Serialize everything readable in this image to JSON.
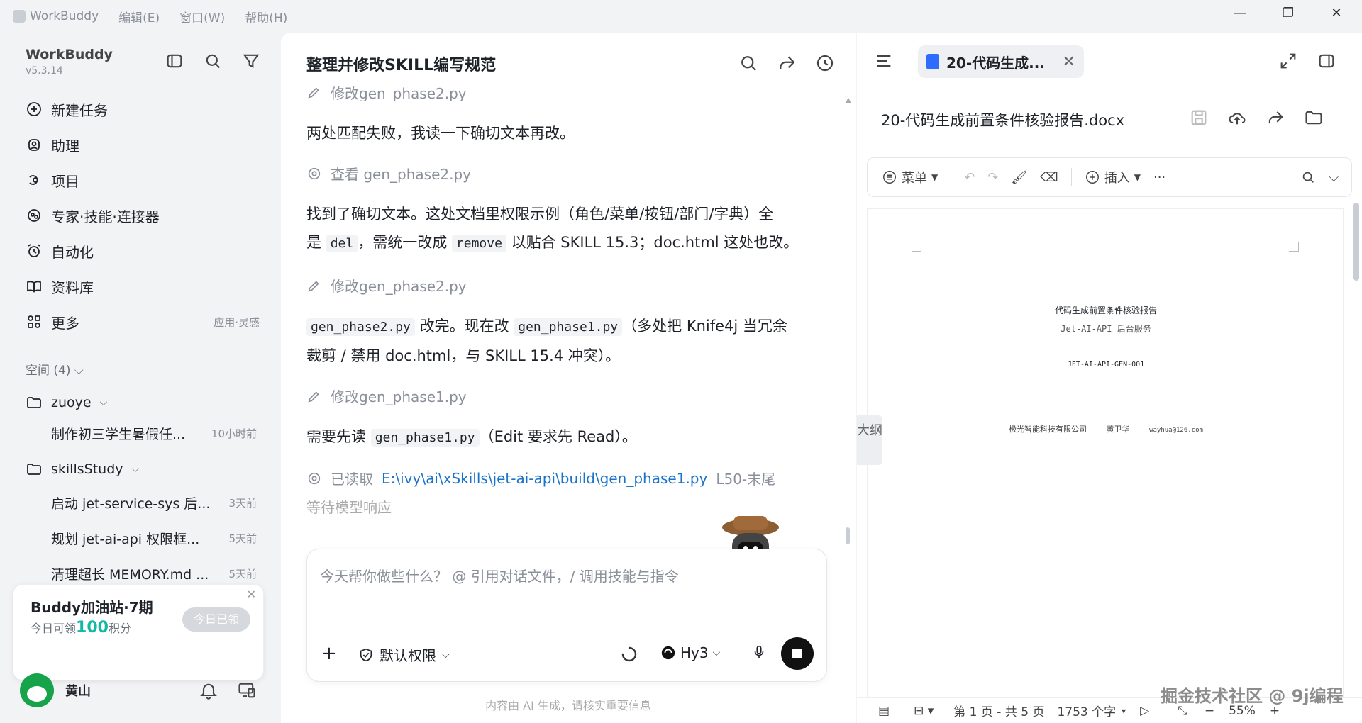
{
  "titlebar": {
    "app_name": "WorkBuddy",
    "menus": [
      "编辑(E)",
      "窗口(W)",
      "帮助(H)"
    ]
  },
  "sidebar": {
    "app_name": "WorkBuddy",
    "version": "v5.3.14",
    "nav": [
      {
        "label": "新建任务",
        "icon": "plus-circle-icon"
      },
      {
        "label": "助理",
        "icon": "assistant-icon"
      },
      {
        "label": "项目",
        "icon": "project-icon"
      },
      {
        "label": "专家·技能·连接器",
        "icon": "skills-icon"
      },
      {
        "label": "自动化",
        "icon": "alarm-icon"
      },
      {
        "label": "资料库",
        "icon": "book-icon"
      },
      {
        "label": "更多",
        "icon": "grid-icon",
        "hint": "应用·灵感"
      }
    ],
    "space_header": "空间 (4)",
    "folders": [
      {
        "name": "zuoye",
        "tasks": [
          {
            "title": "制作初三学生暑假任...",
            "time": "10小时前"
          }
        ]
      },
      {
        "name": "skillsStudy",
        "tasks": [
          {
            "title": "启动 jet-service-sys 后...",
            "time": "3天前"
          },
          {
            "title": "规划 jet-ai-api 权限框...",
            "time": "5天前"
          },
          {
            "title": "清理超长 MEMORY.md ...",
            "time": "5天前"
          }
        ]
      }
    ],
    "promo": {
      "title": "Buddy加油站·7期",
      "sub_prefix": "今日可领",
      "points": "100",
      "sub_suffix": "积分",
      "button": "今日已领"
    },
    "user": {
      "name": "黄山"
    }
  },
  "chat": {
    "title": "整理并修改SKILL编写规范",
    "partial_tool": "修改gen_phase2.py",
    "msg1": "两处匹配失败，我读一下确切文本再改。",
    "tool_view": "查看 gen_phase2.py",
    "msg2_a": "找到了确切文本。这处文档里权限示例（角色/菜单/按钮/部门/字典）全",
    "msg2_b1": "是 ",
    "msg2_code1": "del",
    "msg2_b2": "，需统一改成 ",
    "msg2_code2": "remove",
    "msg2_b3": " 以贴合 SKILL 15.3；doc.html 这处也改。",
    "tool_edit2": "修改gen_phase2.py",
    "msg3_code1": "gen_phase2.py",
    "msg3_a": " 改完。现在改 ",
    "msg3_code2": "gen_phase1.py",
    "msg3_b": "（多处把 Knife4j 当冗余",
    "msg3_c": "裁剪 / 禁用 doc.html，与 SKILL 15.4 冲突）。",
    "tool_edit1": "修改gen_phase1.py",
    "msg4_a": "需要先读 ",
    "msg4_code": "gen_phase1.py",
    "msg4_b": "（Edit 要求先 Read）。",
    "tool_read": "已读取",
    "tool_read_path": "E:\\ivy\\ai\\xSkills\\jet-ai-api\\build\\gen_phase1.py",
    "tool_read_range": "L50-末尾",
    "waiting": "等待模型响应",
    "input_placeholder": "今天帮你做些什么？ @ 引用对话文件，/ 调用技能与指令",
    "permission": "默认权限",
    "model": "Hy3",
    "disclaimer": "内容由 AI 生成，请核实重要信息"
  },
  "doc": {
    "tab_title": "20-代码生成...",
    "file_title": "20-代码生成前置条件核验报告.docx",
    "toolbar": {
      "menu": "菜单",
      "insert": "插入"
    },
    "page": {
      "title": "代码生成前置条件核验报告",
      "subtitle": "Jet-AI-API 后台服务",
      "code": "JET-AI-API-GEN-001",
      "company": "极光智能科技有限公司",
      "author": "黄卫华",
      "email": "wayhua@126.com"
    },
    "outline_label": "大纲",
    "status": {
      "page": "第 1 页 - 共 5 页",
      "words": "1753 个字",
      "zoom": "55%"
    }
  },
  "watermark": "掘金技术社区 @ 9j编程",
  "colors": {
    "accent": "#14b8a6",
    "link": "#1a73c9",
    "doc_icon": "#2f6bff"
  }
}
